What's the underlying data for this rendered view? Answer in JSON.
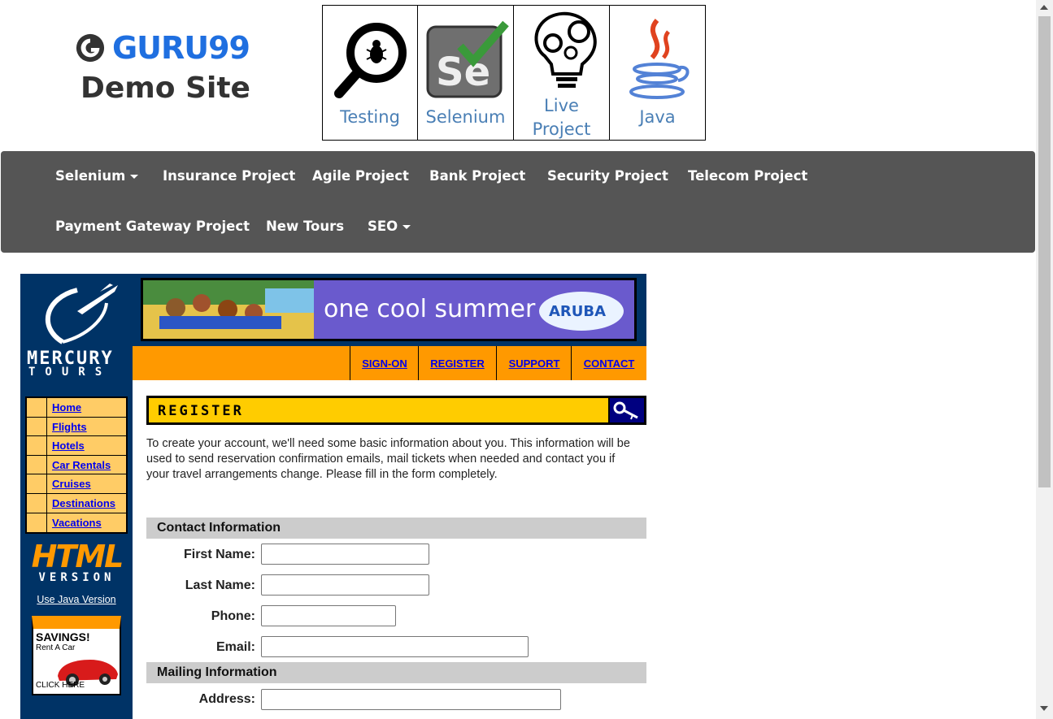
{
  "header": {
    "logo_text": "GURU99",
    "demo_site": "Demo Site",
    "boxes": [
      {
        "label": "Testing",
        "icon": "bug-magnifier-icon"
      },
      {
        "label": "Selenium",
        "icon": "selenium-icon"
      },
      {
        "label_line1": "Live",
        "label_line2": "Project",
        "icon": "gears-bulb-icon"
      },
      {
        "label": "Java",
        "icon": "java-icon"
      }
    ]
  },
  "navbar": {
    "items": [
      "Selenium",
      "Insurance Project",
      "Agile Project",
      "Bank Project",
      "Security Project",
      "Telecom Project",
      "Payment Gateway Project",
      "New Tours",
      "SEO"
    ]
  },
  "mercury": {
    "logo_line1": "MERCURY",
    "logo_line2": "TOURS",
    "banner_text": "one cool summer",
    "banner_brand": "ARUBA",
    "top_links": [
      "SIGN-ON",
      "REGISTER",
      "SUPPORT",
      "CONTACT"
    ],
    "side_menu": [
      "Home",
      "Flights",
      "Hotels",
      "Car Rentals",
      "Cruises",
      "Destinations",
      "Vacations"
    ],
    "html_big": "HTML",
    "html_small": "VERSION",
    "java_link": "Use Java Version",
    "savings_title": "SAVINGS!",
    "savings_sub": "Rent A Car",
    "savings_cta": "CLICK HERE",
    "register_title": "REGISTER",
    "intro": "To create your account, we'll need some basic information about you. This information will be used to send reservation confirmation emails, mail tickets when needed and contact you if your travel arrangements change. Please fill in the form completely.",
    "contact_section": "Contact Information",
    "mailing_section": "Mailing Information",
    "fields": {
      "first_name": {
        "label": "First Name:",
        "value": ""
      },
      "last_name": {
        "label": "Last Name:",
        "value": ""
      },
      "phone": {
        "label": "Phone:",
        "value": ""
      },
      "email": {
        "label": "Email:",
        "value": ""
      },
      "address": {
        "label": "Address:",
        "value": ""
      }
    }
  },
  "colors": {
    "navbar_bg": "#555555",
    "mercury_blue": "#003366",
    "orange": "#ff9900",
    "register_yellow": "#ffcc00",
    "link_blue": "#0000ee"
  }
}
